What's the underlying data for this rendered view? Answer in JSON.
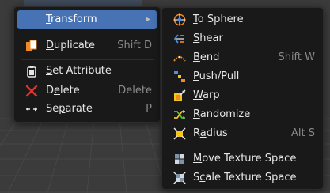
{
  "main_menu": {
    "items": [
      {
        "label": "Transform",
        "mnemonic": "T",
        "rest": "ransform",
        "shortcut": "",
        "has_submenu": true,
        "active": true
      },
      {
        "label": "Duplicate",
        "mnemonic": "D",
        "rest": "uplicate",
        "shortcut": "Shift D"
      },
      {
        "label": "Set Attribute",
        "mnemonic": "S",
        "rest": "et Attribute",
        "shortcut": ""
      },
      {
        "label": "Delete",
        "pre": "D",
        "mnemonic": "e",
        "rest": "lete",
        "shortcut": "Delete"
      },
      {
        "label": "Separate",
        "pre": "Se",
        "mnemonic": "p",
        "rest": "arate",
        "shortcut": "P"
      }
    ],
    "submenu_arrow": "▸"
  },
  "sub_menu": {
    "items": [
      {
        "label": "To Sphere",
        "mnemonic": "T",
        "rest": "o Sphere",
        "shortcut": ""
      },
      {
        "label": "Shear",
        "mnemonic": "S",
        "rest": "hear",
        "shortcut": ""
      },
      {
        "label": "Bend",
        "mnemonic": "B",
        "rest": "end",
        "shortcut": "Shift W"
      },
      {
        "label": "Push/Pull",
        "mnemonic": "P",
        "rest": "ush/Pull",
        "shortcut": ""
      },
      {
        "label": "Warp",
        "mnemonic": "W",
        "rest": "arp",
        "shortcut": ""
      },
      {
        "label": "Randomize",
        "mnemonic": "R",
        "rest": "andomize",
        "shortcut": ""
      },
      {
        "label": "Radius",
        "pre": "R",
        "mnemonic": "a",
        "rest": "dius",
        "shortcut": "Alt S"
      },
      {
        "label": "Move Texture Space",
        "mnemonic": "M",
        "rest": "ove Texture Space",
        "shortcut": ""
      },
      {
        "label": "Scale Texture Space",
        "pre": "S",
        "mnemonic": "c",
        "rest": "ale Texture Space",
        "shortcut": ""
      }
    ]
  },
  "icons": {
    "duplicate": "duplicate-icon",
    "set_attribute": "set-attribute-icon",
    "delete": "delete-x-icon",
    "separate": "separate-arrows-icon",
    "to_sphere": "to-sphere-icon",
    "shear": "shear-icon",
    "bend": "bend-icon",
    "push_pull": "push-pull-icon",
    "warp": "warp-icon",
    "randomize": "randomize-icon",
    "radius": "radius-icon",
    "move_texture_space": "move-texture-space-icon",
    "scale_texture_space": "scale-texture-space-icon"
  },
  "colors": {
    "menu_bg": "#191919",
    "highlight": "#4772b3",
    "text": "#e6e6e6",
    "shortcut_text": "#8a8a8a",
    "icon_orange": "#f08a24",
    "icon_yellow": "#f5c518",
    "icon_red": "#e53030",
    "icon_blue": "#4f8de0",
    "viewport_bg": "#3b3b3b"
  }
}
